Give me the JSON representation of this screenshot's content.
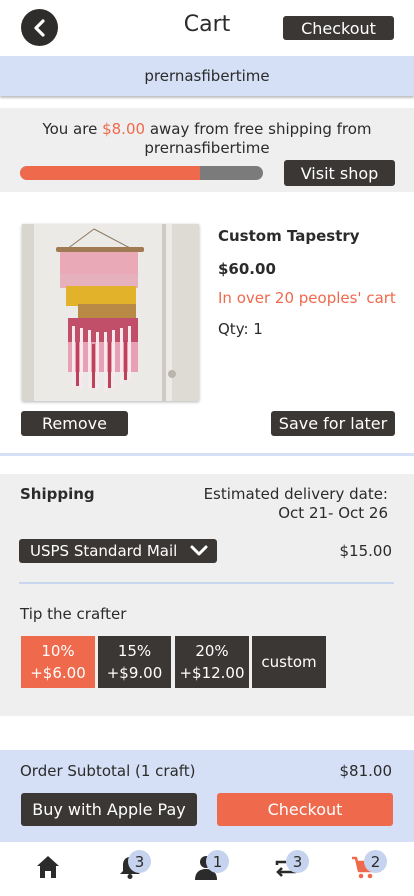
{
  "header": {
    "title": "Cart",
    "checkout_label": "Checkout",
    "back_icon": "chevron-left-icon"
  },
  "shop": {
    "name": "prernasfibertime"
  },
  "free_shipping": {
    "prefix": "You are ",
    "amount": "$8.00",
    "suffix": " away from free shipping from",
    "shop_name": "prernasfibertime",
    "progress_fraction": 0.74,
    "visit_shop_label": "Visit shop"
  },
  "item": {
    "name": "Custom Tapestry",
    "price": "$60.00",
    "popularity": "In over 20 peoples' cart",
    "qty": "Qty: 1",
    "remove_label": "Remove",
    "save_label": "Save for later"
  },
  "shipping": {
    "label": "Shipping",
    "delivery_label": "Estimated delivery date:",
    "delivery_dates": "Oct 21- Oct 26",
    "method": "USPS Standard Mail",
    "cost": "$15.00"
  },
  "tip": {
    "label": "Tip the crafter",
    "options": [
      {
        "percent": "10%",
        "amount": "+$6.00"
      },
      {
        "percent": "15%",
        "amount": "+$9.00"
      },
      {
        "percent": "20%",
        "amount": "+$12.00"
      }
    ],
    "custom_label": "custom"
  },
  "summary": {
    "subtotal_label": "Order Subtotal (1 craft)",
    "subtotal_value": "$81.00",
    "apple_pay_label": "Buy with Apple Pay",
    "checkout_label": "Checkout"
  },
  "tabbar": {
    "items": [
      {
        "icon": "home-icon",
        "badge": ""
      },
      {
        "icon": "bell-icon",
        "badge": "3"
      },
      {
        "icon": "user-icon",
        "badge": "1"
      },
      {
        "icon": "swap-icon",
        "badge": "3"
      },
      {
        "icon": "cart-icon",
        "badge": "2"
      }
    ]
  },
  "colors": {
    "accent": "#ef6a4c",
    "dark": "#3a3735",
    "light_blue": "#d5e0f6",
    "panel": "#efefef"
  }
}
